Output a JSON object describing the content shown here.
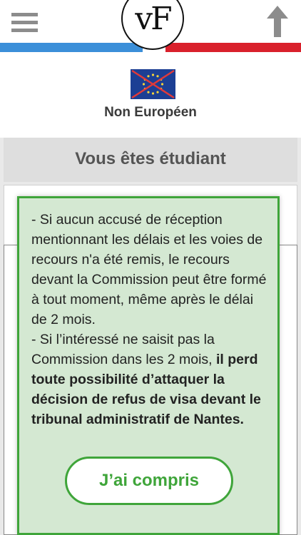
{
  "header": {
    "logo_text": "vF",
    "menu_icon": "hamburger-menu-icon",
    "up_icon": "arrow-up-icon",
    "colors": {
      "blue": "#3b8fd9",
      "white": "#ffffff",
      "red": "#d9202b"
    }
  },
  "nationality": {
    "flag_icon": "eu-flag-crossed-icon",
    "label": "Non Européen"
  },
  "status": {
    "label": "Vous êtes étudiant"
  },
  "modal": {
    "paragraph1": "- Si aucun accusé de réception mentionnant les délais et les voies de recours n'a été remis, le recours devant la Commission peut être formé à tout moment, même après le délai de 2 mois.",
    "paragraph2_normal": "- Si l’intéressé ne saisit pas la Commission dans les 2 mois, ",
    "paragraph2_bold": "il perd toute possibilité d’attaquer la décision de refus de visa devant le tribunal administratif de Nantes.",
    "button_label": "J’ai compris",
    "accent_color": "#3fa53a",
    "background_color": "#d4e8d2"
  }
}
